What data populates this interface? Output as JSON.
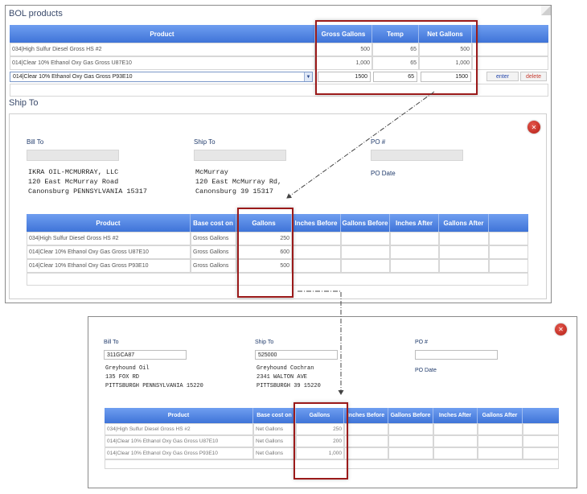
{
  "bol_products": {
    "title": "BOL products",
    "headers": {
      "product": "Product",
      "gross": "Gross Gallons",
      "temp": "Temp",
      "net": "Net Gallons"
    },
    "rows": [
      {
        "product": "034|High Sulfur Diesel Gross HS #2",
        "gross": "500",
        "temp": "65",
        "net": "500"
      },
      {
        "product": "014|Clear 10% Ethanol Oxy Gas Gross U87E10",
        "gross": "1,000",
        "temp": "65",
        "net": "1,000"
      }
    ],
    "edit_row": {
      "product": "014|Clear 10% Ethanol Oxy Gas Gross P93E10",
      "gross": "1500",
      "temp": "65",
      "net": "1500"
    },
    "enter_label": "enter",
    "delete_label": "delete"
  },
  "ship_to_section": {
    "title": "Ship To",
    "bill_to_label": "Bill To",
    "ship_to_label": "Ship To",
    "po_label": "PO #",
    "po_date_label": "PO Date",
    "bill_address": [
      "IKRA OIL-MCMURRAY, LLC",
      "120 East McMurray Road",
      "Canonsburg PENNSYLVANIA 15317"
    ],
    "ship_address": [
      "McMurray",
      "120 East McMurray Rd,",
      "Canonsburg 39 15317"
    ],
    "table": {
      "headers": {
        "product": "Product",
        "base": "Base cost on",
        "gallons": "Gallons",
        "inches_before": "Inches Before",
        "gallons_before": "Gallons Before",
        "inches_after": "Inches After",
        "gallons_after": "Gallons After"
      },
      "rows": [
        {
          "product": "034|High Sulfur Diesel Gross HS #2",
          "base": "Gross Gallons",
          "gallons": "250"
        },
        {
          "product": "014|Clear 10% Ethanol Oxy Gas Gross U87E10",
          "base": "Gross Gallons",
          "gallons": "600"
        },
        {
          "product": "014|Clear 10% Ethanol Oxy Gas Gross P93E10",
          "base": "Gross Gallons",
          "gallons": "500"
        }
      ]
    }
  },
  "second_panel": {
    "bill_to_label": "Bill To",
    "ship_to_label": "Ship To",
    "po_label": "PO #",
    "po_date_label": "PO Date",
    "bill_to_value": "311GCA87",
    "ship_to_value": "525000",
    "bill_address": [
      "Greyhound Oil",
      "135 FOX RD",
      "PITTSBURGH PENNSYLVANIA 15220"
    ],
    "ship_address": [
      "Greyhound Cochran",
      "2341 WALTON AVE",
      "PITTSBURGH 39 15220"
    ],
    "table": {
      "headers": {
        "product": "Product",
        "base": "Base cost on",
        "gallons": "Gallons",
        "inches_before": "Inches Before",
        "gallons_before": "Gallons Before",
        "inches_after": "Inches After",
        "gallons_after": "Gallons After"
      },
      "rows": [
        {
          "product": "034|High Sulfur Diesel Gross HS #2",
          "base": "Net Gallons",
          "gallons": "250"
        },
        {
          "product": "014|Clear 10% Ethanol Oxy Gas Gross U87E10",
          "base": "Net Gallons",
          "gallons": "200"
        },
        {
          "product": "014|Clear 10% Ethanol Oxy Gas Gross P93E10",
          "base": "Net Gallons",
          "gallons": "1,000"
        }
      ]
    }
  },
  "colors": {
    "header_blue": "#4a7fe0",
    "highlight_red": "#9b1a1a",
    "close_red": "#c0281e"
  },
  "icons": {
    "close": "close-icon",
    "dropdown": "chevron-down-icon"
  }
}
